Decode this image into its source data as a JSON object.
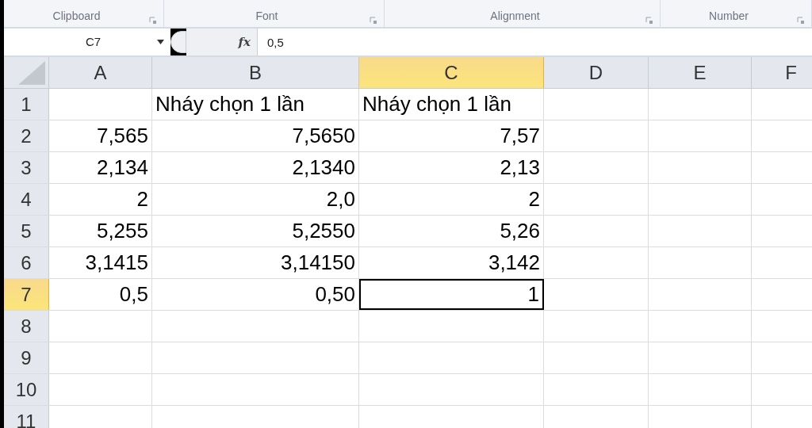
{
  "ribbon_groups": [
    {
      "label": "Clipboard"
    },
    {
      "label": "Font"
    },
    {
      "label": "Alignment"
    },
    {
      "label": "Number"
    }
  ],
  "formula_bar": {
    "name_box": "C7",
    "function_button": "fx",
    "formula": "0,5"
  },
  "columns": [
    {
      "label": "A",
      "selected": false
    },
    {
      "label": "B",
      "selected": false
    },
    {
      "label": "C",
      "selected": true
    },
    {
      "label": "D",
      "selected": false
    },
    {
      "label": "E",
      "selected": false
    },
    {
      "label": "F",
      "selected": false
    }
  ],
  "rows": [
    {
      "label": "1",
      "selected": false,
      "cells": [
        {
          "active": false
        },
        {
          "kind": "text",
          "text": "Nháy chọn 1 lần",
          "active": false
        },
        {
          "kind": "text",
          "text": "Nháy chọn 1 lần",
          "active": false
        }
      ]
    },
    {
      "label": "2",
      "selected": false,
      "cells": [
        {
          "kind": "number",
          "text": "7,565",
          "active": false
        },
        {
          "kind": "number",
          "text": "7,5650",
          "active": false
        },
        {
          "kind": "number",
          "text": "7,57",
          "active": false
        }
      ]
    },
    {
      "label": "3",
      "selected": false,
      "cells": [
        {
          "kind": "number",
          "text": "2,134",
          "active": false
        },
        {
          "kind": "number",
          "text": "2,1340",
          "active": false
        },
        {
          "kind": "number",
          "text": "2,13",
          "active": false
        }
      ]
    },
    {
      "label": "4",
      "selected": false,
      "cells": [
        {
          "kind": "number",
          "text": "2",
          "active": false
        },
        {
          "kind": "number",
          "text": "2,0",
          "active": false
        },
        {
          "kind": "number",
          "text": "2",
          "active": false
        }
      ]
    },
    {
      "label": "5",
      "selected": false,
      "cells": [
        {
          "kind": "number",
          "text": "5,255",
          "active": false
        },
        {
          "kind": "number",
          "text": "5,2550",
          "active": false
        },
        {
          "kind": "number",
          "text": "5,26",
          "active": false
        }
      ]
    },
    {
      "label": "6",
      "selected": false,
      "cells": [
        {
          "kind": "number",
          "text": "3,1415",
          "active": false
        },
        {
          "kind": "number",
          "text": "3,14150",
          "active": false
        },
        {
          "kind": "number",
          "text": "3,142",
          "active": false
        }
      ]
    },
    {
      "label": "7",
      "selected": true,
      "cells": [
        {
          "kind": "number",
          "text": "0,5",
          "active": false
        },
        {
          "kind": "number",
          "text": "0,50",
          "active": false
        },
        {
          "kind": "number",
          "text": "1",
          "active": true
        }
      ]
    },
    {
      "label": "8",
      "selected": false
    },
    {
      "label": "9",
      "selected": false
    },
    {
      "label": "10",
      "selected": false
    },
    {
      "label": "11",
      "selected": false
    }
  ]
}
